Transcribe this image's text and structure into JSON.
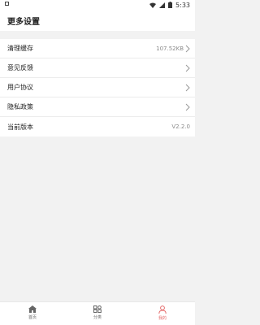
{
  "status_bar": {
    "time": "5:33"
  },
  "header": {
    "title": "更多设置"
  },
  "settings": {
    "items": [
      {
        "label": "清理缓存",
        "value": "107.52KB"
      },
      {
        "label": "意见反馈"
      },
      {
        "label": "用户协议"
      },
      {
        "label": "隐私政策"
      },
      {
        "label": "当前版本",
        "value": "V2.2.0"
      }
    ]
  },
  "tabs": [
    {
      "label": "首页",
      "icon": "home-icon"
    },
    {
      "label": "分类",
      "icon": "grid-icon"
    },
    {
      "label": "我的",
      "icon": "user-icon",
      "active": true
    }
  ],
  "colors": {
    "accent": "#e56b6b",
    "background": "#f2f2f2"
  }
}
